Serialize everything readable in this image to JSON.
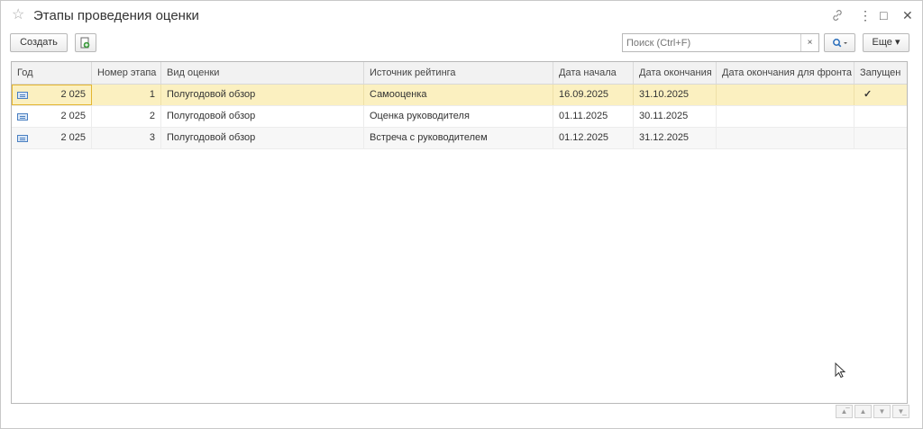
{
  "window": {
    "title": "Этапы проведения оценки",
    "controls": {
      "link": "🔗",
      "menu": "⋮",
      "maximize": "□",
      "close": "✕"
    }
  },
  "toolbar": {
    "create_label": "Создать",
    "search_placeholder": "Поиск (Ctrl+F)",
    "search_clear": "×",
    "search_button": "🔍▾",
    "more_label": "Еще ▾"
  },
  "table": {
    "columns": [
      "Год",
      "Номер этапа",
      "Вид оценки",
      "Источник рейтинга",
      "Дата начала",
      "Дата окончания",
      "Дата окончания для фронта",
      "Запущен"
    ],
    "rows": [
      {
        "year": "2 025",
        "stage": "1",
        "kind": "Полугодовой обзор",
        "source": "Самооценка",
        "start": "16.09.2025",
        "end": "31.10.2025",
        "front_end": "",
        "started": "✓"
      },
      {
        "year": "2 025",
        "stage": "2",
        "kind": "Полугодовой обзор",
        "source": "Оценка руководителя",
        "start": "01.11.2025",
        "end": "30.11.2025",
        "front_end": "",
        "started": ""
      },
      {
        "year": "2 025",
        "stage": "3",
        "kind": "Полугодовой обзор",
        "source": "Встреча с руководителем",
        "start": "01.12.2025",
        "end": "31.12.2025",
        "front_end": "",
        "started": ""
      }
    ]
  },
  "colors": {
    "selected_row": "#fbf0c0",
    "check": "#2e9a2e",
    "focus": "#e4b52f"
  }
}
